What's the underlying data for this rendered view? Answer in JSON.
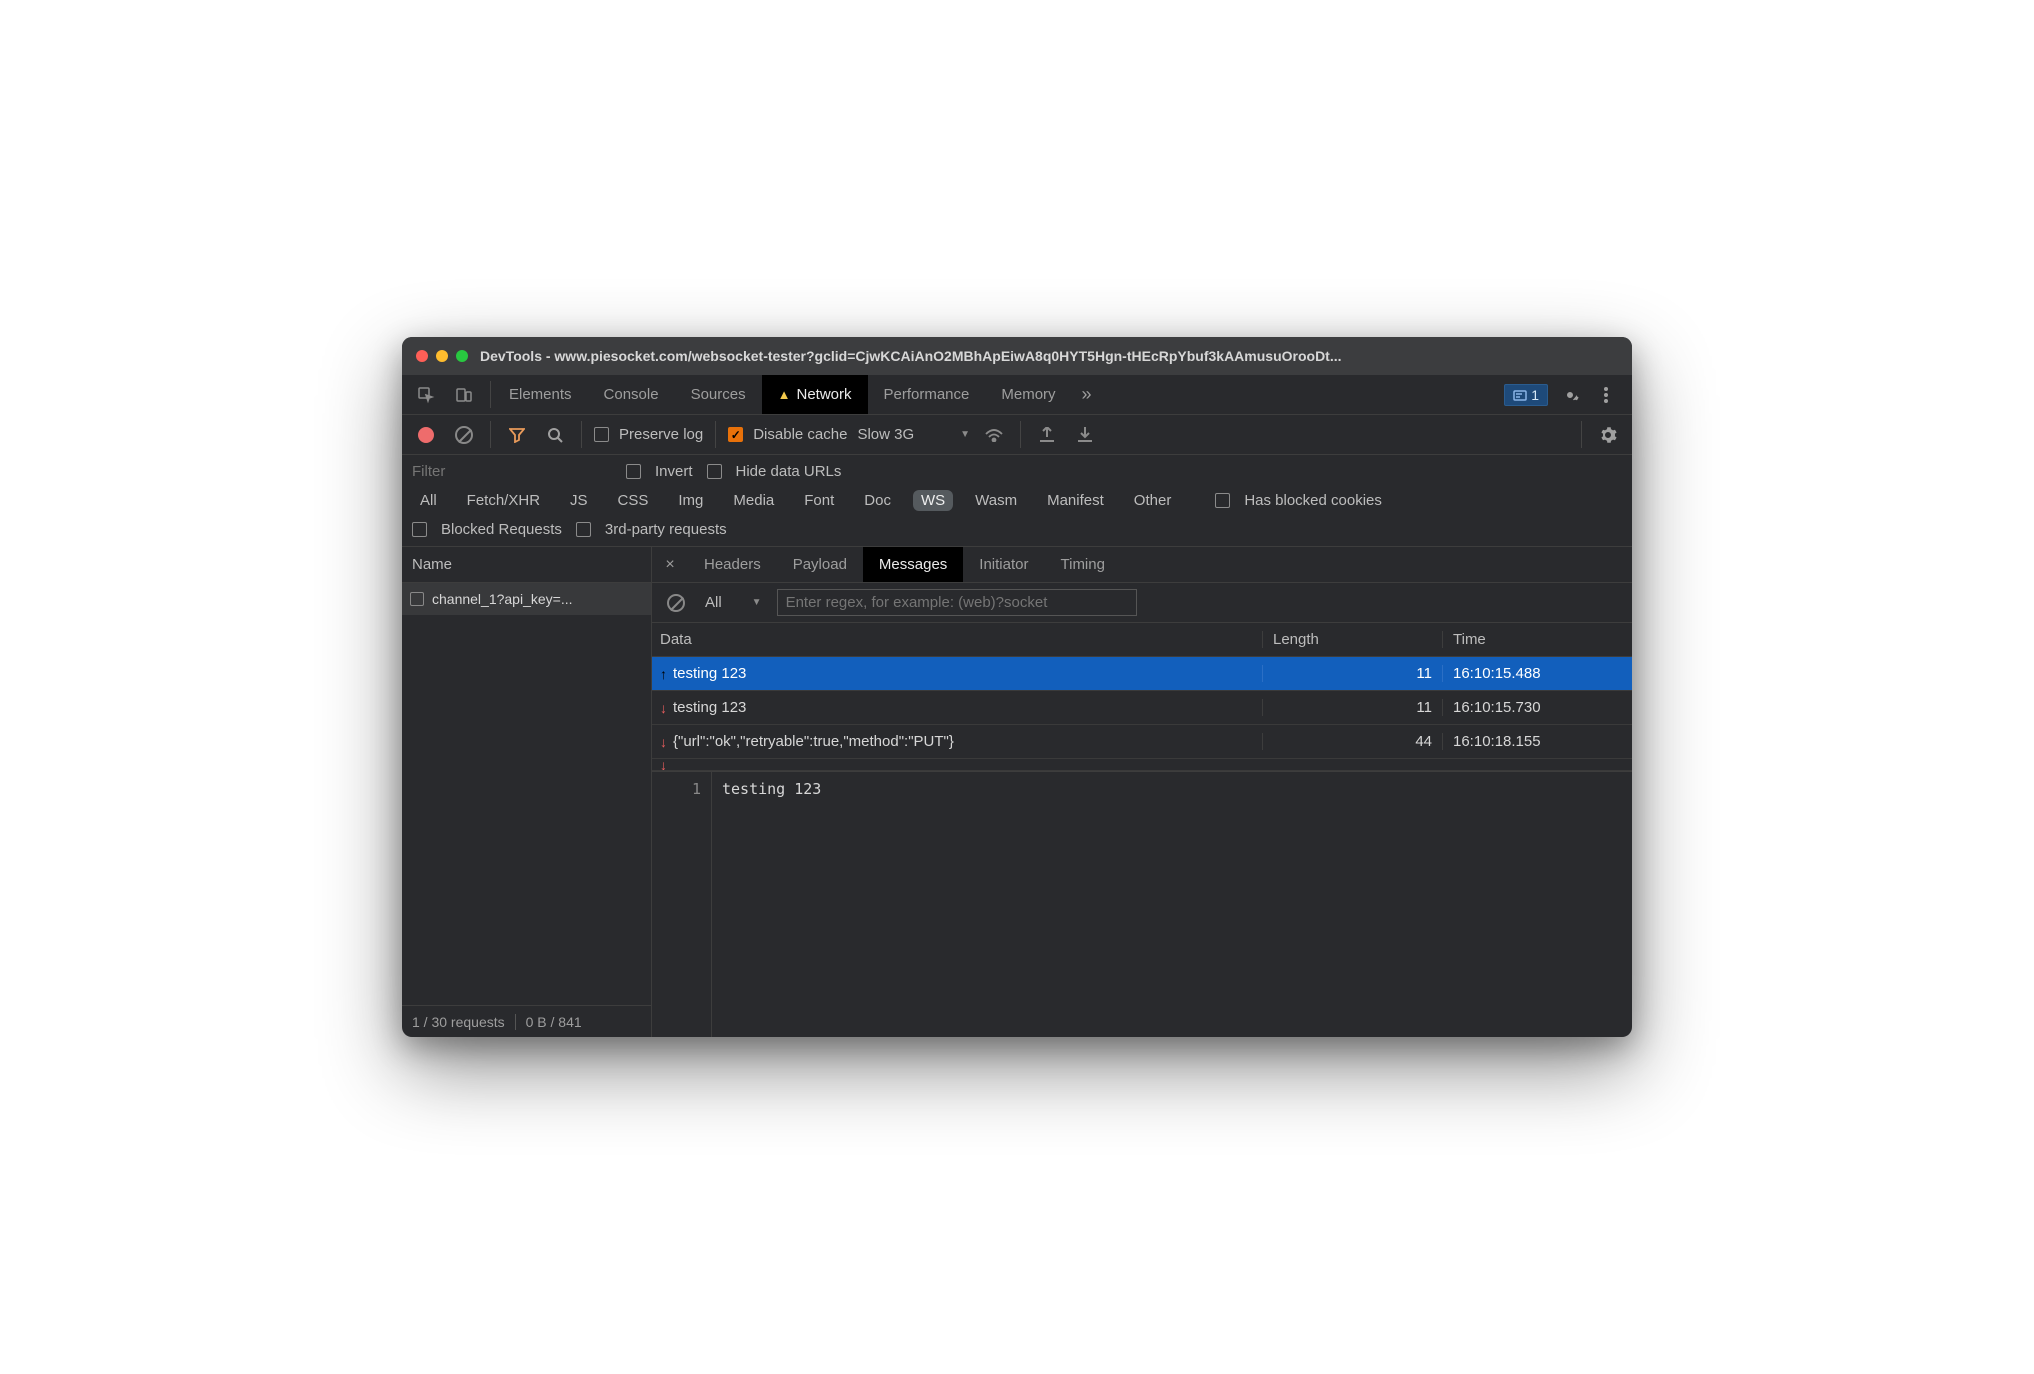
{
  "window": {
    "title": "DevTools - www.piesocket.com/websocket-tester?gclid=CjwKCAiAnO2MBhApEiwA8q0HYT5Hgn-tHEcRpYbuf3kAAmusuOrooDt..."
  },
  "tabs": {
    "items": [
      "Elements",
      "Console",
      "Sources",
      "Network",
      "Performance",
      "Memory"
    ],
    "active": "Network",
    "issues_count": "1"
  },
  "toolbar": {
    "preserve_log": "Preserve log",
    "disable_cache": "Disable cache",
    "throttling": "Slow 3G"
  },
  "filterbar": {
    "filter_placeholder": "Filter",
    "invert": "Invert",
    "hide_data_urls": "Hide data URLs",
    "types": [
      "All",
      "Fetch/XHR",
      "JS",
      "CSS",
      "Img",
      "Media",
      "Font",
      "Doc",
      "WS",
      "Wasm",
      "Manifest",
      "Other"
    ],
    "type_active": "WS",
    "has_blocked_cookies": "Has blocked cookies",
    "blocked_requests": "Blocked Requests",
    "third_party": "3rd-party requests"
  },
  "sidebar": {
    "name_header": "Name",
    "requests": [
      {
        "name": "channel_1?api_key=..."
      }
    ],
    "status_left": "1 / 30 requests",
    "status_right": "0 B / 841"
  },
  "detail": {
    "tabs": [
      "Headers",
      "Payload",
      "Messages",
      "Initiator",
      "Timing"
    ],
    "active": "Messages"
  },
  "messages": {
    "filter_all": "All",
    "regex_placeholder": "Enter regex, for example: (web)?socket",
    "columns": {
      "data": "Data",
      "length": "Length",
      "time": "Time"
    },
    "rows": [
      {
        "dir": "up",
        "data": "testing 123",
        "length": "11",
        "time": "16:10:15.488",
        "selected": true
      },
      {
        "dir": "down",
        "data": "testing 123",
        "length": "11",
        "time": "16:10:15.730"
      },
      {
        "dir": "down",
        "data": "{\"url\":\"ok\",\"retryable\":true,\"method\":\"PUT\"}",
        "length": "44",
        "time": "16:10:18.155"
      }
    ]
  },
  "preview": {
    "line_no": "1",
    "content": "testing 123"
  }
}
